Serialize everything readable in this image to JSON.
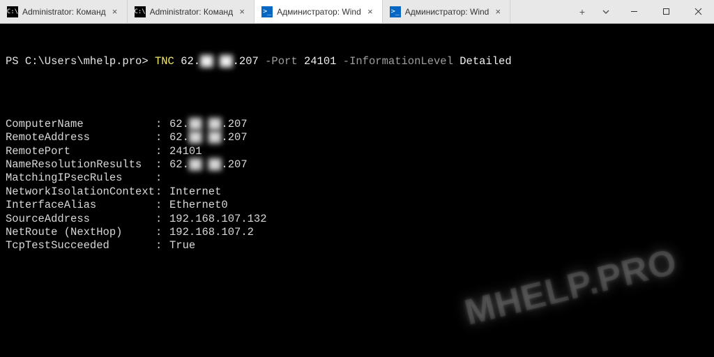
{
  "tabs": [
    {
      "icon": "cmd",
      "label": "Administrator: Команд",
      "active": false
    },
    {
      "icon": "cmd",
      "label": "Administrator: Команд",
      "active": false
    },
    {
      "icon": "ps",
      "label": "Администратор: Wind",
      "active": true
    },
    {
      "icon": "ps",
      "label": "Администратор: Wind",
      "active": false
    }
  ],
  "tab_icon_text": {
    "cmd": "C:\\",
    "ps": ">_"
  },
  "prompt": "PS C:\\Users\\mhelp.pro>",
  "command": {
    "exe": "TNC",
    "ip_pre": "62.",
    "ip_mid": "██ ██",
    "ip_post": ".207",
    "flag_port": "-Port",
    "port": "24101",
    "flag_info": "-InformationLevel",
    "level": "Detailed"
  },
  "output": [
    {
      "k": "ComputerName",
      "v_pre": "62.",
      "v_blur": "██ ██",
      "v_post": ".207"
    },
    {
      "k": "RemoteAddress",
      "v_pre": "62.",
      "v_blur": "██ ██",
      "v_post": ".207"
    },
    {
      "k": "RemotePort",
      "v": "24101"
    },
    {
      "k": "NameResolutionResults",
      "v_pre": "62.",
      "v_blur": "██ ██",
      "v_post": ".207"
    },
    {
      "k": "MatchingIPsecRules",
      "v": ""
    },
    {
      "k": "NetworkIsolationContext",
      "v": "Internet"
    },
    {
      "k": "InterfaceAlias",
      "v": "Ethernet0"
    },
    {
      "k": "SourceAddress",
      "v": "192.168.107.132"
    },
    {
      "k": "NetRoute (NextHop)",
      "v": "192.168.107.2"
    },
    {
      "k": "TcpTestSucceeded",
      "v": "True"
    }
  ],
  "watermark": "MHELP.PRO"
}
